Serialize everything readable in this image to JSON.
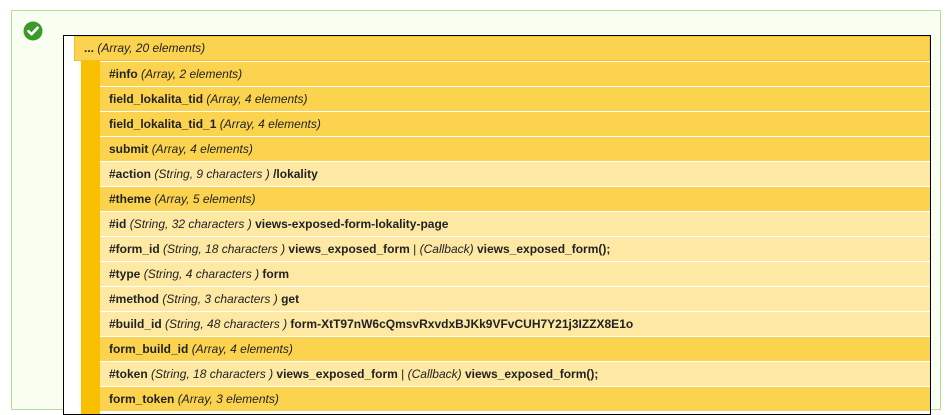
{
  "root": {
    "label": "...",
    "type": "(Array, 20 elements)"
  },
  "rows": [
    {
      "key": "#info",
      "type": "(Array, 2 elements)",
      "kind": "expandable"
    },
    {
      "key": "field_lokalita_tid",
      "type": "(Array, 4 elements)",
      "kind": "expandable"
    },
    {
      "key": "field_lokalita_tid_1",
      "type": "(Array, 4 elements)",
      "kind": "expandable"
    },
    {
      "key": "submit",
      "type": "(Array, 4 elements)",
      "kind": "expandable"
    },
    {
      "key": "#action",
      "type": "(String, 9 characters )",
      "value": "/lokality",
      "kind": "leaf"
    },
    {
      "key": "#theme",
      "type": "(Array, 5 elements)",
      "kind": "expandable"
    },
    {
      "key": "#id",
      "type": "(String, 32 characters )",
      "value": "views-exposed-form-lokality-page",
      "kind": "leaf"
    },
    {
      "key": "#form_id",
      "type": "(String, 18 characters )",
      "value": "views_exposed_form",
      "sep": "|",
      "callback_type": "(Callback)",
      "callback": "views_exposed_form();",
      "kind": "leaf"
    },
    {
      "key": "#type",
      "type": "(String, 4 characters )",
      "value": "form",
      "kind": "leaf"
    },
    {
      "key": "#method",
      "type": "(String, 3 characters )",
      "value": "get",
      "kind": "leaf"
    },
    {
      "key": "#build_id",
      "type": "(String, 48 characters )",
      "value": "form-XtT97nW6cQmsvRxvdxBJKk9VFvCUH7Y21j3IZZX8E1o",
      "kind": "leaf"
    },
    {
      "key": "form_build_id",
      "type": "(Array, 4 elements)",
      "kind": "expandable"
    },
    {
      "key": "#token",
      "type": "(String, 18 characters )",
      "value": "views_exposed_form",
      "sep": "|",
      "callback_type": "(Callback)",
      "callback": "views_exposed_form();",
      "kind": "leaf"
    },
    {
      "key": "form_token",
      "type": "(Array, 3 elements)",
      "kind": "expandable"
    }
  ],
  "colors": {
    "status_border": "#b9da97",
    "status_background": "#f8fff0",
    "expandable_row": "#fcd34e",
    "leaf_row": "#fde9a4",
    "gutter": "#f8c000",
    "status_icon": "#3b9a2a"
  },
  "icons": {
    "status": "checkmark-circle-icon"
  }
}
